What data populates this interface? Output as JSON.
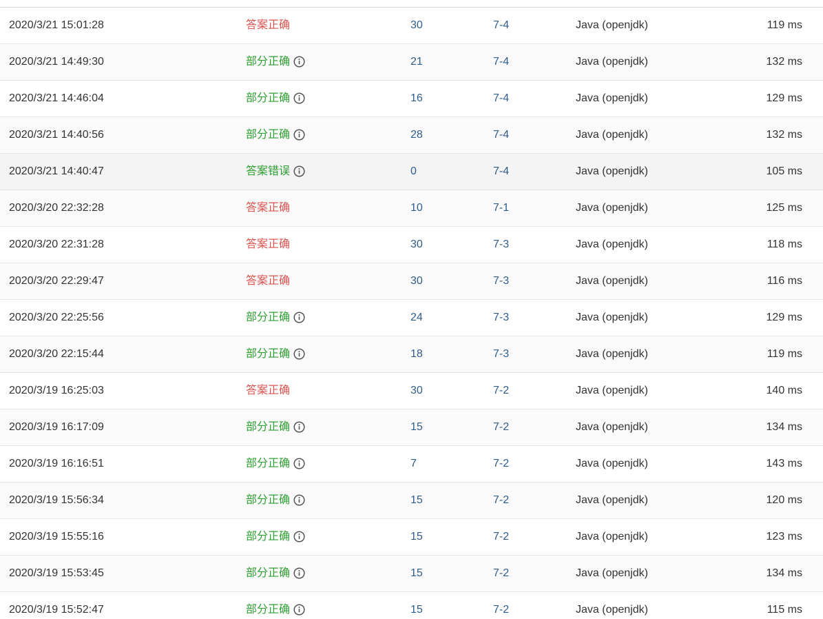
{
  "colors": {
    "accepted": "#d9534f",
    "partial": "#2e9f32",
    "wrong": "#2e9f32",
    "link": "#2f5d8a"
  },
  "rows": [
    {
      "time": "2020/3/21 15:01:28",
      "status": "答案正确",
      "status_type": "accepted",
      "info": false,
      "score": "30",
      "problem": "7-4",
      "lang": "Java (openjdk)",
      "time_used": "119 ms"
    },
    {
      "time": "2020/3/21 14:49:30",
      "status": "部分正确",
      "status_type": "partial",
      "info": true,
      "score": "21",
      "problem": "7-4",
      "lang": "Java (openjdk)",
      "time_used": "132 ms"
    },
    {
      "time": "2020/3/21 14:46:04",
      "status": "部分正确",
      "status_type": "partial",
      "info": true,
      "score": "16",
      "problem": "7-4",
      "lang": "Java (openjdk)",
      "time_used": "129 ms"
    },
    {
      "time": "2020/3/21 14:40:56",
      "status": "部分正确",
      "status_type": "partial",
      "info": true,
      "score": "28",
      "problem": "7-4",
      "lang": "Java (openjdk)",
      "time_used": "132 ms"
    },
    {
      "time": "2020/3/21 14:40:47",
      "status": "答案错误",
      "status_type": "wrong",
      "info": true,
      "score": "0",
      "problem": "7-4",
      "lang": "Java (openjdk)",
      "time_used": "105 ms"
    },
    {
      "time": "2020/3/20 22:32:28",
      "status": "答案正确",
      "status_type": "accepted",
      "info": false,
      "score": "10",
      "problem": "7-1",
      "lang": "Java (openjdk)",
      "time_used": "125 ms"
    },
    {
      "time": "2020/3/20 22:31:28",
      "status": "答案正确",
      "status_type": "accepted",
      "info": false,
      "score": "30",
      "problem": "7-3",
      "lang": "Java (openjdk)",
      "time_used": "118 ms"
    },
    {
      "time": "2020/3/20 22:29:47",
      "status": "答案正确",
      "status_type": "accepted",
      "info": false,
      "score": "30",
      "problem": "7-3",
      "lang": "Java (openjdk)",
      "time_used": "116 ms"
    },
    {
      "time": "2020/3/20 22:25:56",
      "status": "部分正确",
      "status_type": "partial",
      "info": true,
      "score": "24",
      "problem": "7-3",
      "lang": "Java (openjdk)",
      "time_used": "129 ms"
    },
    {
      "time": "2020/3/20 22:15:44",
      "status": "部分正确",
      "status_type": "partial",
      "info": true,
      "score": "18",
      "problem": "7-3",
      "lang": "Java (openjdk)",
      "time_used": "119 ms"
    },
    {
      "time": "2020/3/19 16:25:03",
      "status": "答案正确",
      "status_type": "accepted",
      "info": false,
      "score": "30",
      "problem": "7-2",
      "lang": "Java (openjdk)",
      "time_used": "140 ms"
    },
    {
      "time": "2020/3/19 16:17:09",
      "status": "部分正确",
      "status_type": "partial",
      "info": true,
      "score": "15",
      "problem": "7-2",
      "lang": "Java (openjdk)",
      "time_used": "134 ms"
    },
    {
      "time": "2020/3/19 16:16:51",
      "status": "部分正确",
      "status_type": "partial",
      "info": true,
      "score": "7",
      "problem": "7-2",
      "lang": "Java (openjdk)",
      "time_used": "143 ms"
    },
    {
      "time": "2020/3/19 15:56:34",
      "status": "部分正确",
      "status_type": "partial",
      "info": true,
      "score": "15",
      "problem": "7-2",
      "lang": "Java (openjdk)",
      "time_used": "120 ms"
    },
    {
      "time": "2020/3/19 15:55:16",
      "status": "部分正确",
      "status_type": "partial",
      "info": true,
      "score": "15",
      "problem": "7-2",
      "lang": "Java (openjdk)",
      "time_used": "123 ms"
    },
    {
      "time": "2020/3/19 15:53:45",
      "status": "部分正确",
      "status_type": "partial",
      "info": true,
      "score": "15",
      "problem": "7-2",
      "lang": "Java (openjdk)",
      "time_used": "134 ms"
    },
    {
      "time": "2020/3/19 15:52:47",
      "status": "部分正确",
      "status_type": "partial",
      "info": true,
      "score": "15",
      "problem": "7-2",
      "lang": "Java (openjdk)",
      "time_used": "115 ms"
    }
  ]
}
